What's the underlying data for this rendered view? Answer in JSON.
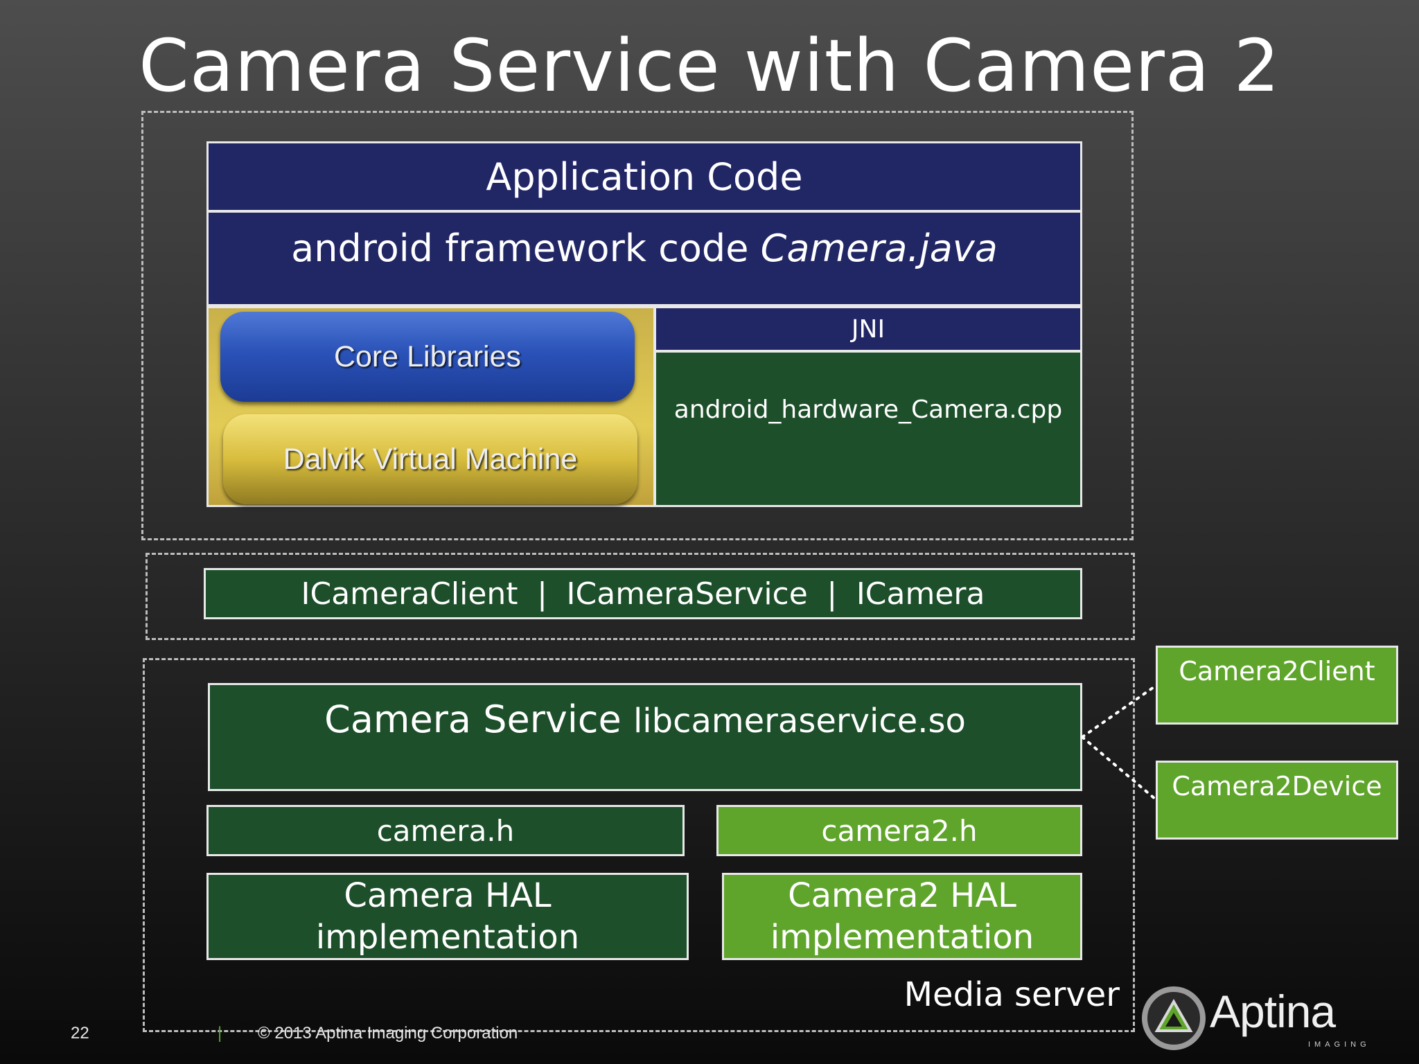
{
  "title": "Camera Service with Camera 2",
  "app_stack": {
    "application_code": "Application Code",
    "framework_prefix": "android framework code",
    "framework_file": "Camera.java",
    "core_libraries": "Core Libraries",
    "dalvik": "Dalvik Virtual Machine",
    "jni": "JNI",
    "jni_cpp": "android_hardware_Camera.cpp"
  },
  "binder": {
    "items": [
      "ICameraClient",
      "ICameraService",
      "ICamera"
    ],
    "separator": "|"
  },
  "media_server": {
    "label": "Media server",
    "camera_service": "Camera Service",
    "camera_service_lib": "libcameraservice.so",
    "camera_h": "camera.h",
    "camera2_h": "camera2.h",
    "camera_hal_line1": "Camera HAL",
    "camera_hal_line2": "implementation",
    "camera2_hal_line1": "Camera2 HAL",
    "camera2_hal_line2": "implementation"
  },
  "side_boxes": {
    "camera2_client": "Camera2Client",
    "camera2_device": "Camera2Device"
  },
  "footer": {
    "page_number": "22",
    "divider": "|",
    "copyright": "© 2013 Aptina Imaging Corporation"
  },
  "logo": {
    "brand": "Aptina",
    "tagline": "IMAGING"
  },
  "colors": {
    "navy": "#212665",
    "dark_green": "#1c4f2a",
    "light_green": "#5fa52b"
  }
}
